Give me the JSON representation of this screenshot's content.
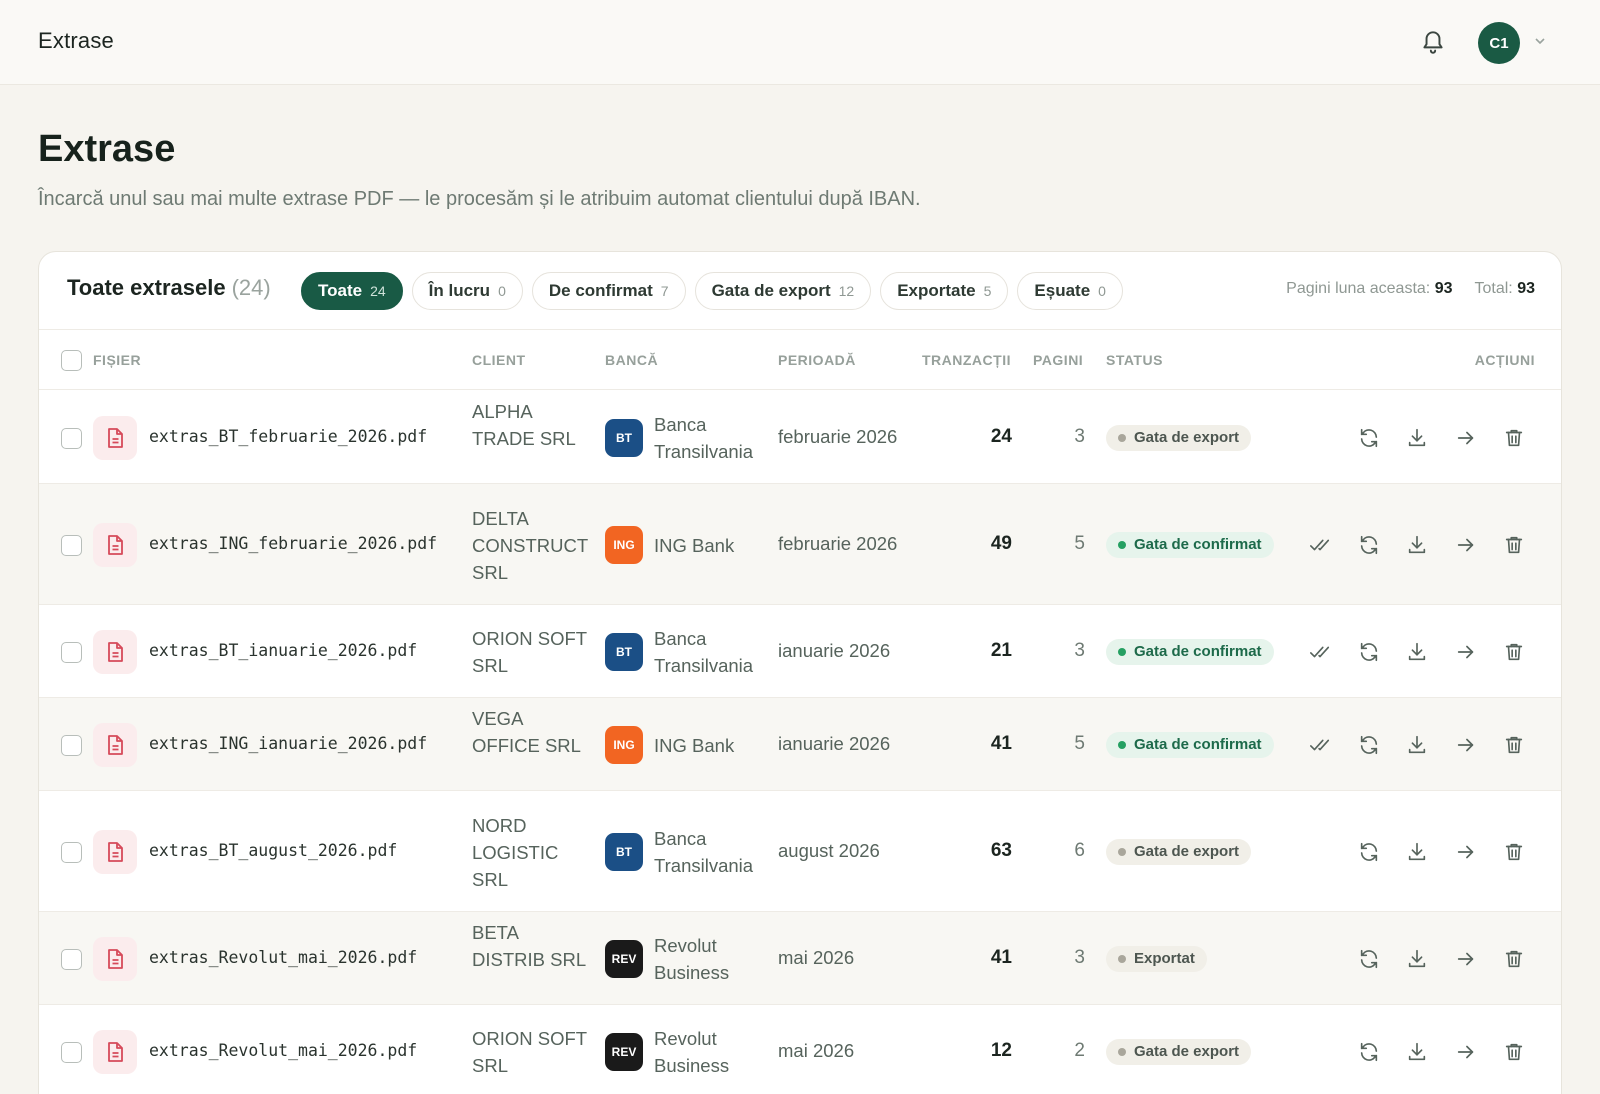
{
  "topbar": {
    "title": "Extrase",
    "avatar_initials": "C1"
  },
  "page": {
    "title": "Extrase",
    "subtitle": "Încarcă unul sau mai multe extrase PDF — le procesăm și le atribuim automat clientului după IBAN."
  },
  "card": {
    "title": "Toate extrasele",
    "count": "(24)",
    "filters": [
      {
        "label": "Toate",
        "count": "24"
      },
      {
        "label": "În lucru",
        "count": "0"
      },
      {
        "label": "De confirmat",
        "count": "7"
      },
      {
        "label": "Gata de export",
        "count": "12"
      },
      {
        "label": "Exportate",
        "count": "5"
      },
      {
        "label": "Eșuate",
        "count": "0"
      }
    ],
    "stats": {
      "pages_month_label": "Pagini luna aceasta:",
      "pages_month_value": "93",
      "total_label": "Total:",
      "total_value": "93"
    }
  },
  "table": {
    "columns": {
      "file": "FIȘIER",
      "client": "CLIENT",
      "bank": "BANCĂ",
      "period": "PERIOADĂ",
      "transactions": "TRANZACȚII",
      "pages": "PAGINI",
      "status": "STATUS",
      "actions": "ACȚIUNI"
    },
    "rows": [
      {
        "file": "extras_BT_februarie_2026.pdf",
        "client": "ALPHA TRADE SRL",
        "bank_code": "BT",
        "bank": "Banca Transilvania",
        "period": "februarie 2026",
        "transactions": "24",
        "pages": "3",
        "status": "Gata de export"
      },
      {
        "file": "extras_ING_februarie_2026.pdf",
        "client": "DELTA CONSTRUCT SRL",
        "bank_code": "ING",
        "bank": "ING Bank",
        "period": "februarie 2026",
        "transactions": "49",
        "pages": "5",
        "status": "Gata de confirmat"
      },
      {
        "file": "extras_BT_ianuarie_2026.pdf",
        "client": "ORION SOFT SRL",
        "bank_code": "BT",
        "bank": "Banca Transilvania",
        "period": "ianuarie 2026",
        "transactions": "21",
        "pages": "3",
        "status": "Gata de confirmat"
      },
      {
        "file": "extras_ING_ianuarie_2026.pdf",
        "client": "VEGA OFFICE SRL",
        "bank_code": "ING",
        "bank": "ING Bank",
        "period": "ianuarie 2026",
        "transactions": "41",
        "pages": "5",
        "status": "Gata de confirmat"
      },
      {
        "file": "extras_BT_august_2026.pdf",
        "client": "NORD LOGISTIC SRL",
        "bank_code": "BT",
        "bank": "Banca Transilvania",
        "period": "august 2026",
        "transactions": "63",
        "pages": "6",
        "status": "Gata de export"
      },
      {
        "file": "extras_Revolut_mai_2026.pdf",
        "client": "BETA DISTRIB SRL",
        "bank_code": "REV",
        "bank": "Revolut Business",
        "period": "mai 2026",
        "transactions": "41",
        "pages": "3",
        "status": "Exportat"
      },
      {
        "file": "extras_Revolut_mai_2026.pdf",
        "client": "ORION SOFT SRL",
        "bank_code": "REV",
        "bank": "Revolut Business",
        "period": "mai 2026",
        "transactions": "12",
        "pages": "2",
        "status": "Gata de export"
      }
    ]
  },
  "colors": {
    "accent": "#195a45",
    "bank_bt": "#1b4f86",
    "bank_ing": "#f26522",
    "bank_rev": "#1a1a1a",
    "status_confirm": "#25a062",
    "file_icon": "#d64a5a"
  },
  "icons": {
    "notification": "bell-icon",
    "account_menu": "chevron-down-icon",
    "file": "file-pdf-icon",
    "confirm": "double-check-icon",
    "reprocess": "refresh-icon",
    "download": "download-icon",
    "open": "arrow-right-icon",
    "delete": "trash-icon"
  }
}
